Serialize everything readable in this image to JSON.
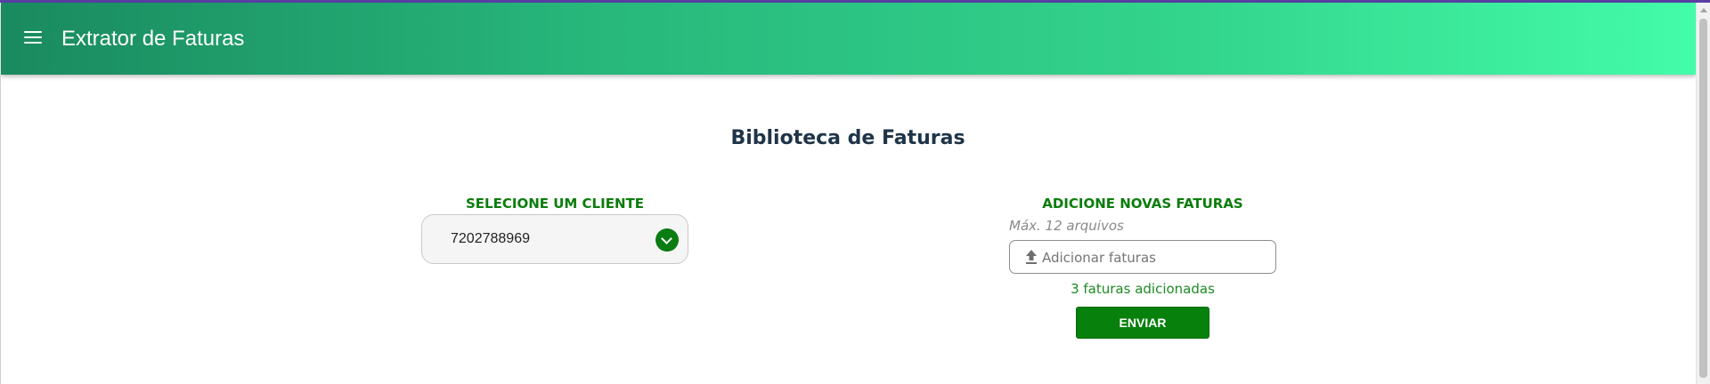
{
  "header": {
    "title": "Extrator de Faturas",
    "menu_icon": "hamburger-menu-icon"
  },
  "main": {
    "title": "Biblioteca de Faturas",
    "client_section": {
      "label": "SELECIONE UM CLIENTE",
      "selected_value": "7202788969",
      "dropdown_icon": "chevron-down-icon"
    },
    "upload_section": {
      "label": "ADICIONE NOVAS FATURAS",
      "hint": "Máx. 12 arquivos",
      "placeholder": "Adicionar faturas",
      "upload_icon": "upload-icon",
      "added_status": "3 faturas adicionadas",
      "send_label": "ENVIAR"
    }
  },
  "colors": {
    "header_gradient_start": "#1a8a5f",
    "header_gradient_end": "#43fca9",
    "accent_green": "#0b7d0b",
    "button_green": "#07800c",
    "title_dark": "#1f3447"
  }
}
